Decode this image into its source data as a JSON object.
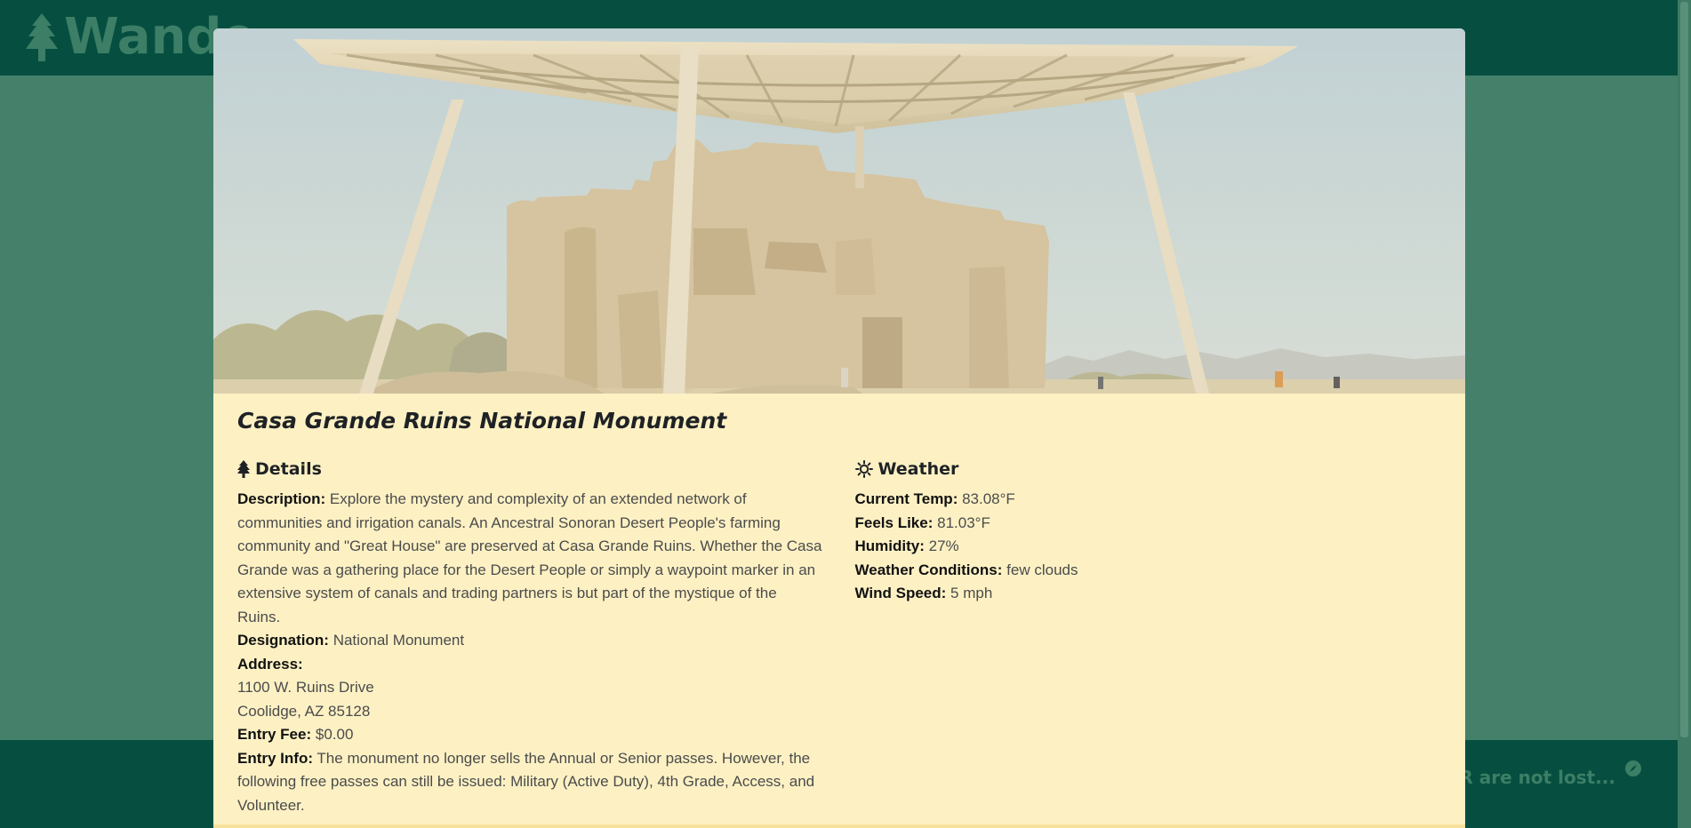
{
  "navbar": {
    "brand": "Wande"
  },
  "footer": {
    "text": "ANDER are not lost..."
  },
  "modal": {
    "title": "Casa Grande Ruins National Monument",
    "details": {
      "heading": "Details",
      "description_label": "Description:",
      "description": "Explore the mystery and complexity of an extended network of communities and irrigation canals. An Ancestral Sonoran Desert People's farming community and \"Great House\" are preserved at Casa Grande Ruins. Whether the Casa Grande was a gathering place for the Desert People or simply a waypoint marker in an extensive system of canals and trading partners is but part of the mystique of the Ruins.",
      "designation_label": "Designation:",
      "designation": "National Monument",
      "address_label": "Address:",
      "address_line1": "1100 W. Ruins Drive",
      "address_line2": "Coolidge, AZ 85128",
      "entry_fee_label": "Entry Fee:",
      "entry_fee": "$0.00",
      "entry_info_label": "Entry Info:",
      "entry_info": "The monument no longer sells the Annual or Senior passes. However, the following free passes can still be issued: Military (Active Duty), 4th Grade, Access, and Volunteer."
    },
    "weather": {
      "heading": "Weather",
      "current_temp_label": "Current Temp:",
      "current_temp": "83.08°F",
      "feels_like_label": "Feels Like:",
      "feels_like": "81.03°F",
      "humidity_label": "Humidity:",
      "humidity": "27%",
      "conditions_label": "Weather Conditions:",
      "conditions": "few clouds",
      "wind_speed_label": "Wind Speed:",
      "wind_speed": "5 mph"
    }
  },
  "colors": {
    "navbar": "#064f40",
    "page_background": "#45806a",
    "modal_background": "#fdf1c4"
  },
  "icons": {
    "brand": "tree-icon",
    "details": "tree-icon",
    "weather": "sun-icon",
    "footer": "compass-icon"
  }
}
